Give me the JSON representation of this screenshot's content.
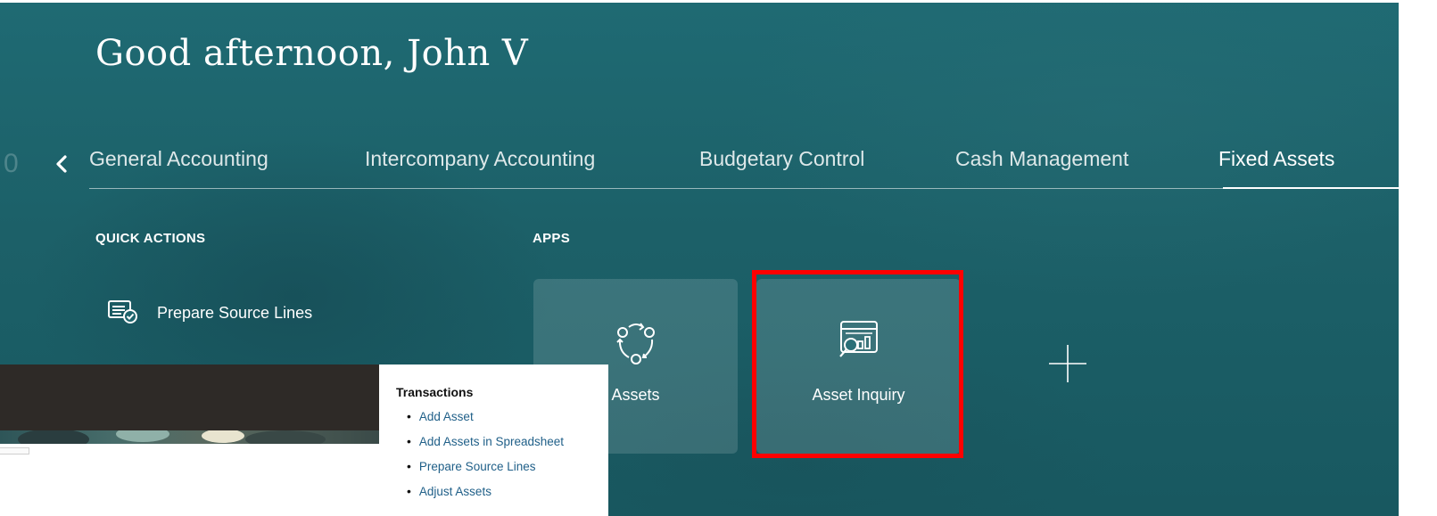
{
  "header": {
    "greeting": "Good afternoon, John V"
  },
  "nav": {
    "partial_left_glyph": "0",
    "tabs": [
      {
        "label": "General Accounting",
        "active": false
      },
      {
        "label": "Intercompany Accounting",
        "active": false
      },
      {
        "label": "Budgetary Control",
        "active": false
      },
      {
        "label": "Cash Management",
        "active": false
      },
      {
        "label": "Fixed Assets",
        "active": true
      }
    ]
  },
  "quick_actions": {
    "heading": "QUICK ACTIONS",
    "items": [
      {
        "label": "Prepare Source Lines",
        "icon": "prepare-source-lines-icon"
      }
    ],
    "more": "•••"
  },
  "apps": {
    "heading": "APPS",
    "tiles": [
      {
        "label": "Assets",
        "icon": "assets-cycle-icon"
      },
      {
        "label": "Asset Inquiry",
        "icon": "asset-inquiry-icon",
        "highlighted": true
      }
    ],
    "add_icon": "plus-icon"
  },
  "overlay_panel": {
    "title": "Transactions",
    "items": [
      "Add Asset",
      "Add Assets in Spreadsheet",
      "Prepare Source Lines",
      "Adjust Assets"
    ]
  },
  "colors": {
    "background": "#1c6068",
    "highlight_border": "#ff0000",
    "link": "#1f5f88"
  }
}
